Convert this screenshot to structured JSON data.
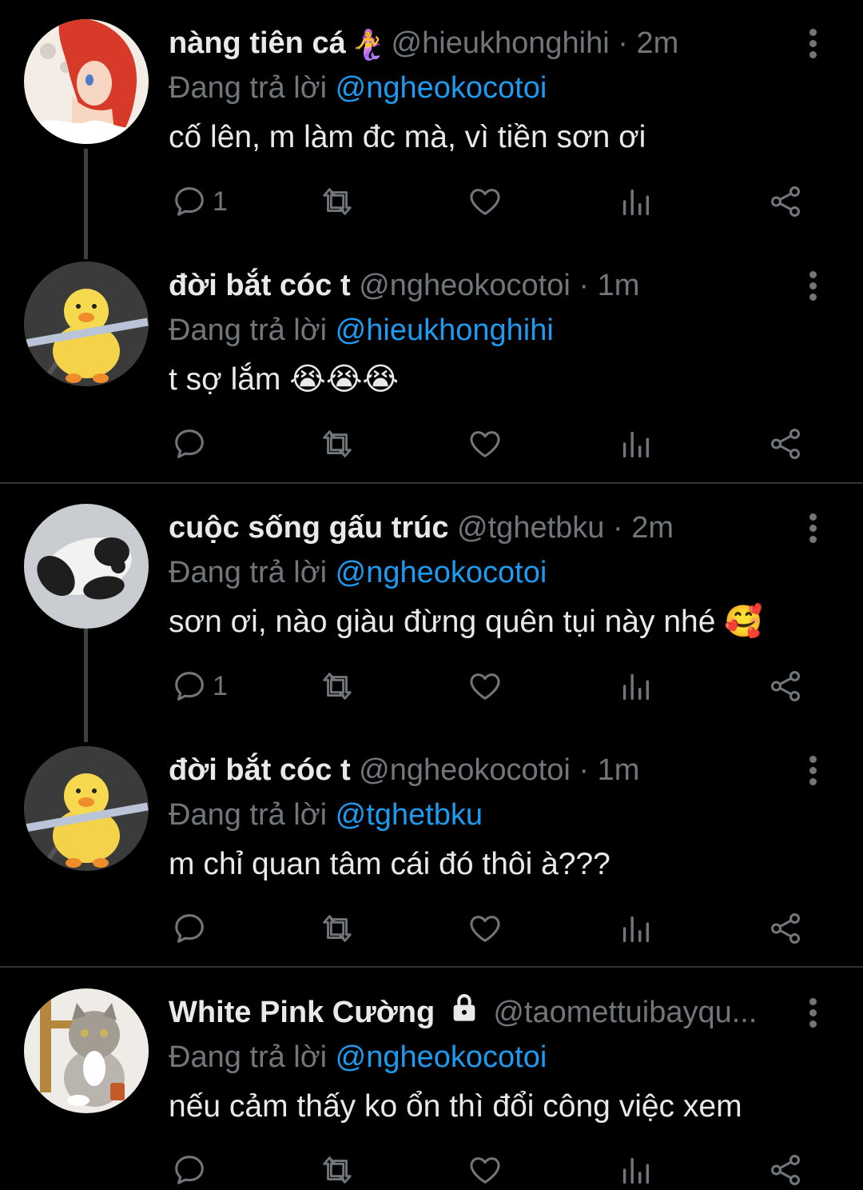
{
  "colors": {
    "background": "#000000",
    "text": "#e7e9ea",
    "muted": "#71767b",
    "link": "#1d9bf0"
  },
  "reply_prefix": "Đang trả lời",
  "tweets": [
    {
      "name": "nàng tiên cá",
      "name_emoji": "🧜‍♀️",
      "handle": "@hieukhonghihi",
      "sep": "·",
      "time": "2m",
      "reply_to": "@ngheokocotoi",
      "text": "cố lên, m làm đc mà, vì tiền sơn ơi",
      "reply_count": "1",
      "avatar": "mermaid-avatar"
    },
    {
      "name": "đời bắt cóc t",
      "handle": "@ngheokocotoi",
      "sep": "·",
      "time": "1m",
      "reply_to": "@hieukhonghihi",
      "text": "t sợ lắm 😭😭😭",
      "reply_count": "",
      "avatar": "duck-avatar"
    },
    {
      "name": "cuộc sống gấu trúc",
      "handle": "@tghetbku",
      "sep": "·",
      "time": "2m",
      "reply_to": "@ngheokocotoi",
      "text": "sơn ơi, nào giàu đừng quên tụi này nhé 🥰",
      "reply_count": "1",
      "avatar": "panda-avatar"
    },
    {
      "name": "đời bắt cóc t",
      "handle": "@ngheokocotoi",
      "sep": "·",
      "time": "1m",
      "reply_to": "@tghetbku",
      "text": "m chỉ quan tâm cái đó thôi à???",
      "reply_count": "",
      "avatar": "duck-avatar"
    },
    {
      "name": "White Pink Cường",
      "handle": "@taomettuibayqu...",
      "sep": "",
      "time": "",
      "reply_to": "@ngheokocotoi",
      "text": "nếu cảm thấy ko ổn thì đổi công việc xem",
      "reply_count": "",
      "avatar": "cat-avatar",
      "locked": true
    }
  ]
}
